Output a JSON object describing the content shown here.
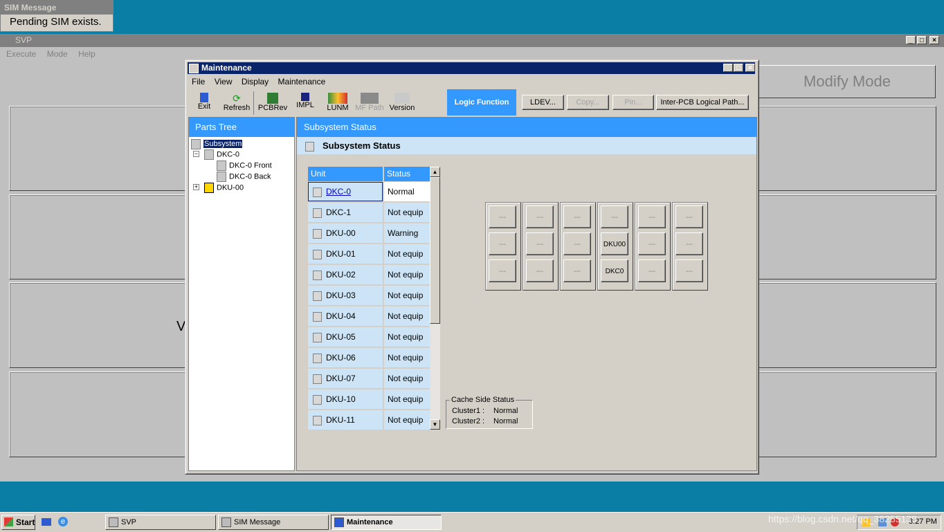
{
  "sim_message": {
    "title": "SIM Message",
    "text": "Pending SIM exists."
  },
  "svp": {
    "title": "SVP",
    "menu": [
      "Execute",
      "Mode",
      "Help"
    ],
    "mode_label": "Modify Mode",
    "partial_text": "V"
  },
  "maintenance": {
    "title": "Maintenance",
    "menu": [
      "File",
      "View",
      "Display",
      "Maintenance"
    ],
    "toolbar": [
      {
        "label": "Exit",
        "icon": "exit-icon"
      },
      {
        "label": "Refresh",
        "icon": "refresh-icon"
      },
      {
        "label": "PCBRev",
        "icon": "pcb-icon"
      },
      {
        "label": "IMPL",
        "icon": "chip-icon"
      },
      {
        "label": "LUNM",
        "icon": "lun-icon"
      },
      {
        "label": "MF Path",
        "icon": "path-icon",
        "disabled": true
      },
      {
        "label": "Version",
        "icon": "version-icon"
      }
    ],
    "logic_function": "Logic Function",
    "buttons": [
      {
        "label": "LDEV...",
        "disabled": false
      },
      {
        "label": "Copy...",
        "disabled": true
      },
      {
        "label": "Pin...",
        "disabled": true
      },
      {
        "label": "Inter-PCB Logical Path...",
        "disabled": false
      }
    ],
    "parts_tree": {
      "header": "Parts Tree",
      "items": [
        "Subsystem",
        "DKC-0",
        "DKC-0 Front",
        "DKC-0 Back",
        "DKU-00"
      ]
    },
    "status_header": "Subsystem Status",
    "status_subheader": "Subsystem Status",
    "table": {
      "columns": [
        "Unit",
        "Status"
      ],
      "rows": [
        {
          "unit": "DKC-0",
          "status": "Normal"
        },
        {
          "unit": "DKC-1",
          "status": "Not equip"
        },
        {
          "unit": "DKU-00",
          "status": "Warning"
        },
        {
          "unit": "DKU-01",
          "status": "Not equip"
        },
        {
          "unit": "DKU-02",
          "status": "Not equip"
        },
        {
          "unit": "DKU-03",
          "status": "Not equip"
        },
        {
          "unit": "DKU-04",
          "status": "Not equip"
        },
        {
          "unit": "DKU-05",
          "status": "Not equip"
        },
        {
          "unit": "DKU-06",
          "status": "Not equip"
        },
        {
          "unit": "DKU-07",
          "status": "Not equip"
        },
        {
          "unit": "DKU-10",
          "status": "Not equip"
        },
        {
          "unit": "DKU-11",
          "status": "Not equip"
        }
      ]
    },
    "rack": [
      [
        "---",
        "---",
        "---"
      ],
      [
        "---",
        "---",
        "---"
      ],
      [
        "---",
        "---",
        "---"
      ],
      [
        "---",
        "DKU00",
        "DKC0"
      ],
      [
        "---",
        "---",
        "---"
      ],
      [
        "---",
        "---",
        "---"
      ]
    ],
    "cache": {
      "title": "Cache Side Status",
      "cluster1_label": "Cluster1  :",
      "cluster1_value": "Normal",
      "cluster2_label": "Cluster2  :",
      "cluster2_value": "Normal"
    }
  },
  "taskbar": {
    "start": "Start",
    "tasks": [
      "SVP",
      "SIM Message",
      "Maintenance"
    ],
    "clock": "3:27 PM",
    "watermark": "https://blog.csdn.net/qq_38255139"
  }
}
